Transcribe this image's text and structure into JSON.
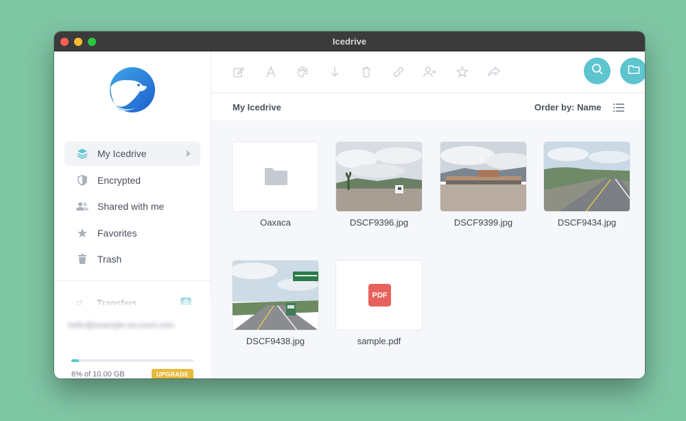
{
  "window": {
    "title": "Icedrive"
  },
  "sidebar": {
    "nav": [
      {
        "label": "My Icedrive",
        "icon": "layers-icon",
        "active": true
      },
      {
        "label": "Encrypted",
        "icon": "shield-icon",
        "active": false
      },
      {
        "label": "Shared with me",
        "icon": "users-icon",
        "active": false
      },
      {
        "label": "Favorites",
        "icon": "star-icon",
        "active": false
      },
      {
        "label": "Trash",
        "icon": "trash-icon",
        "active": false
      }
    ],
    "transfers": {
      "label": "Transfers",
      "count": "0"
    },
    "account": {
      "email": "hello@example-account.com",
      "storage_percent": 6,
      "storage_text": "6% of 10.00 GB",
      "upgrade_label": "UPGRADE"
    }
  },
  "toolbar": {
    "tools": [
      "edit-icon",
      "rename-icon",
      "color-icon",
      "download-icon",
      "delete-icon",
      "link-icon",
      "add-user-icon",
      "favorite-icon",
      "share-icon"
    ],
    "actions": [
      "search-icon",
      "folder-icon",
      "upload-cloud-icon"
    ]
  },
  "subbar": {
    "breadcrumb": "My Icedrive",
    "order_label": "Order by: Name"
  },
  "files": [
    {
      "name": "Oaxaca",
      "type": "folder"
    },
    {
      "name": "DSCF9396.jpg",
      "type": "image"
    },
    {
      "name": "DSCF9399.jpg",
      "type": "image"
    },
    {
      "name": "DSCF9434.jpg",
      "type": "image"
    },
    {
      "name": "DSCF9438.jpg",
      "type": "image"
    },
    {
      "name": "sample.pdf",
      "type": "pdf",
      "badge": "PDF"
    }
  ],
  "colors": {
    "accent": "#5ec5cf",
    "upgrade": "#e7b93d",
    "pdf": "#e8625d",
    "background": "#7fc6a4"
  }
}
